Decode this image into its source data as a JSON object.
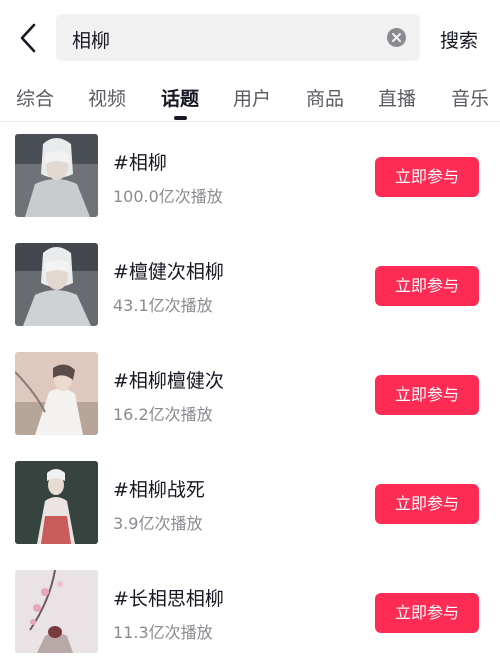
{
  "header": {
    "search_query": "相柳",
    "search_button": "搜索"
  },
  "tabs": [
    {
      "label": "综合"
    },
    {
      "label": "视频"
    },
    {
      "label": "话题",
      "active": true
    },
    {
      "label": "用户"
    },
    {
      "label": "商品"
    },
    {
      "label": "直播"
    },
    {
      "label": "音乐"
    }
  ],
  "results": [
    {
      "title": "#相柳",
      "plays": "100.0亿次播放",
      "action": "立即参与"
    },
    {
      "title": "#檀健次相柳",
      "plays": "43.1亿次播放",
      "action": "立即参与"
    },
    {
      "title": "#相柳檀健次",
      "plays": "16.2亿次播放",
      "action": "立即参与"
    },
    {
      "title": "#相柳战死",
      "plays": "3.9亿次播放",
      "action": "立即参与"
    },
    {
      "title": "#长相思相柳",
      "plays": "11.3亿次播放",
      "action": "立即参与"
    }
  ],
  "colors": {
    "accent": "#fe2c55",
    "text": "#161823",
    "secondary_text": "#8a8b91"
  },
  "icons": {
    "back": "chevron-left-icon",
    "clear": "clear-circle-icon"
  }
}
